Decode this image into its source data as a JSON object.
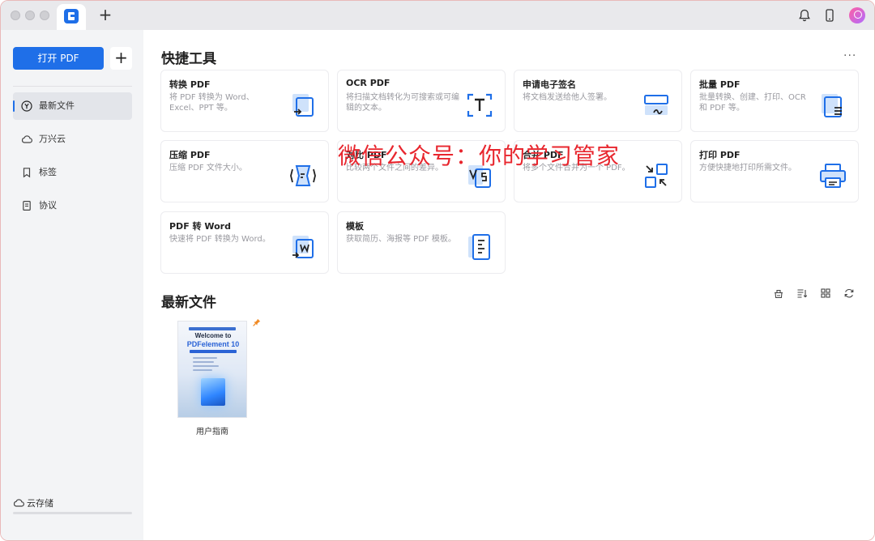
{
  "titlebar": {
    "new_tab": "+"
  },
  "sidebar": {
    "open_button": "打开 PDF",
    "add_button": "+",
    "items": [
      {
        "label": "最新文件",
        "icon": "recent-icon",
        "active": true
      },
      {
        "label": "万兴云",
        "icon": "cloud-icon",
        "active": false
      },
      {
        "label": "标签",
        "icon": "bookmark-icon",
        "active": false
      },
      {
        "label": "协议",
        "icon": "document-icon",
        "active": false
      }
    ],
    "cloud_storage": "云存储"
  },
  "main": {
    "quick_tools_title": "快捷工具",
    "more": "···",
    "tools": [
      {
        "title": "转换 PDF",
        "desc": "将 PDF 转换为 Word、Excel、PPT 等。",
        "icon": "convert-icon"
      },
      {
        "title": "OCR PDF",
        "desc": "将扫描文档转化为可搜索或可编辑的文本。",
        "icon": "ocr-icon"
      },
      {
        "title": "申请电子签名",
        "desc": "将文档发送给他人签署。",
        "icon": "signature-icon"
      },
      {
        "title": "批量 PDF",
        "desc": "批量转换、创建、打印、OCR 和 PDF 等。",
        "icon": "batch-icon"
      },
      {
        "title": "压缩 PDF",
        "desc": "压缩 PDF 文件大小。",
        "icon": "compress-icon"
      },
      {
        "title": "对比 PDF",
        "desc": "比较两个文件之间的差异。",
        "icon": "compare-icon"
      },
      {
        "title": "合并 PDF",
        "desc": "将多个文件合并为一个 PDF。",
        "icon": "merge-icon"
      },
      {
        "title": "打印 PDF",
        "desc": "方便快捷地打印所需文件。",
        "icon": "print-icon"
      },
      {
        "title": "PDF 转 Word",
        "desc": "快速将 PDF 转换为 Word。",
        "icon": "pdf-to-word-icon"
      },
      {
        "title": "模板",
        "desc": "获取简历、海报等 PDF 模板。",
        "icon": "template-icon"
      }
    ],
    "recent_title": "最新文件",
    "recent_files": [
      {
        "name": "用户指南",
        "thumb_title": "Welcome to",
        "thumb_subtitle": "PDFelement 10",
        "pinned": true
      }
    ]
  },
  "watermark": "微信公众号：你的学习管家",
  "colors": {
    "accent": "#1f6fe8",
    "watermark": "#e8262e",
    "sidebar_bg": "#f3f4f6"
  }
}
